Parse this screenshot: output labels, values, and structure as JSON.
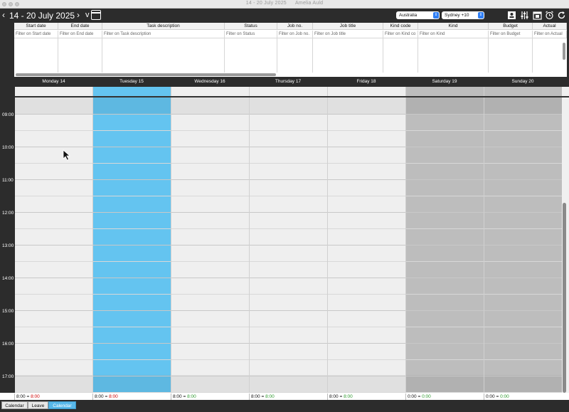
{
  "window": {
    "title": "14 - 20 July 2025",
    "user": "Amelia Auld"
  },
  "toolbar": {
    "prev_icon": "chevron-left-icon",
    "next_icon": "chevron-right-icon",
    "date_range": "14 - 20 July 2025",
    "view_toggle": "v",
    "region_select": "Australia",
    "timezone_select": "Sydney +10",
    "icons": [
      "contacts-icon",
      "sliders-icon",
      "calendar-day-icon",
      "alarm-clock-icon",
      "refresh-icon"
    ]
  },
  "grid": {
    "columns": [
      {
        "label": "Start date",
        "filter": "Filter on Start date"
      },
      {
        "label": "End date",
        "filter": "Filter on End date"
      },
      {
        "label": "Task description",
        "filter": "Filter on Task description"
      },
      {
        "label": "Status",
        "filter": "Filter on Status"
      },
      {
        "label": "Job no.",
        "filter": "Filter on Job no."
      },
      {
        "label": "Job title",
        "filter": "Filter on Job title"
      },
      {
        "label": "Kind code",
        "filter": "Filter on Kind co"
      },
      {
        "label": "Kind",
        "filter": "Filter on Kind"
      },
      {
        "label": "Budget",
        "filter": "Filter on Budget"
      },
      {
        "label": "Actual",
        "filter": "Filter on Actual"
      }
    ]
  },
  "days": [
    {
      "label": "Monday 14",
      "total": "8:00 = ",
      "total_val": "8:00",
      "total_color": "red"
    },
    {
      "label": "Tuesday 15",
      "total": "8:00 = ",
      "total_val": "8:00",
      "total_color": "red"
    },
    {
      "label": "Wednesday 16",
      "total": "8:00 = ",
      "total_val": "8:00",
      "total_color": "green"
    },
    {
      "label": "Thursday 17",
      "total": "8:00 = ",
      "total_val": "8:00",
      "total_color": "green"
    },
    {
      "label": "Friday 18",
      "total": "8:00 = ",
      "total_val": "8:00",
      "total_color": "green"
    },
    {
      "label": "Saturday 19",
      "total": "0:00 = ",
      "total_val": "0:00",
      "total_color": "green"
    },
    {
      "label": "Sunday 20",
      "total": "0:00 = ",
      "total_val": "0:00",
      "total_color": "green"
    }
  ],
  "times": [
    "09:00",
    "10:00",
    "11:00",
    "12:00",
    "13:00",
    "14:00",
    "15:00",
    "16:00",
    "17:00"
  ],
  "selected_day": "Tuesday 15",
  "colors": {
    "selected": "#64c4f0",
    "weekend": "#bdbdbd",
    "weekday": "#efefef"
  },
  "tabs": [
    {
      "label": "Calendar",
      "active": false
    },
    {
      "label": "Leave",
      "active": false
    },
    {
      "label": "Calendar",
      "active": true
    }
  ]
}
